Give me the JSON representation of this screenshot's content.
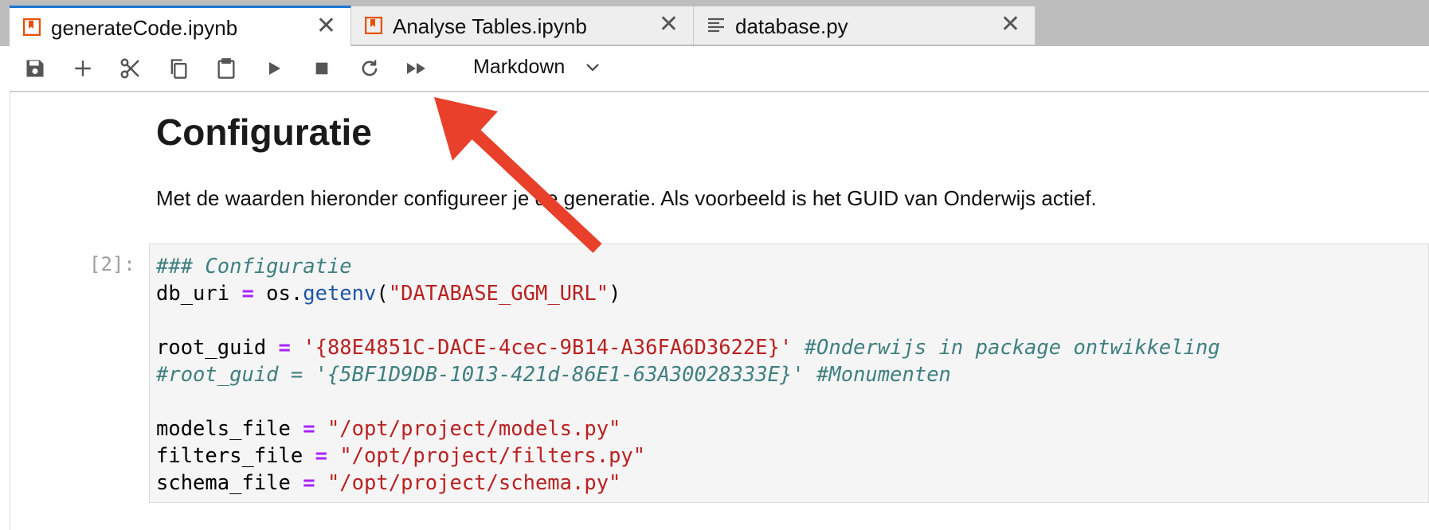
{
  "tabs": [
    {
      "label": "generateCode.ipynb",
      "icon": "notebook-icon",
      "active": true
    },
    {
      "label": "Analyse Tables.ipynb",
      "icon": "notebook-icon",
      "active": false
    },
    {
      "label": "database.py",
      "icon": "text-file-icon",
      "active": false
    }
  ],
  "toolbar": {
    "buttons": [
      "save-icon",
      "add-icon",
      "cut-icon",
      "copy-icon",
      "paste-icon",
      "run-icon",
      "stop-icon",
      "restart-icon",
      "run-all-icon"
    ],
    "cell_type": "Markdown"
  },
  "markdown_cell": {
    "heading": "Configuratie",
    "paragraph": "Met de waarden hieronder configureer je de generatie. Als voorbeeld is het GUID van Onderwijs actief."
  },
  "code_cell": {
    "prompt": "[2]:",
    "lines": [
      "### Configuratie",
      "db_uri = os.getenv(\"DATABASE_GGM_URL\")",
      "",
      "root_guid = '{88E4851C-DACE-4cec-9B14-A36FA6D3622E}' #Onderwijs in package ontwikkeling",
      "#root_guid = '{5BF1D9DB-1013-421d-86E1-63A30028333E}' #Monumenten",
      "",
      "models_file = \"/opt/project/models.py\"",
      "filters_file = \"/opt/project/filters.py\"",
      "schema_file = \"/opt/project/schema.py\""
    ]
  },
  "colors": {
    "accent": "#1976d2",
    "notebook_icon": "#e65100",
    "annotation_arrow": "#e8402a"
  }
}
